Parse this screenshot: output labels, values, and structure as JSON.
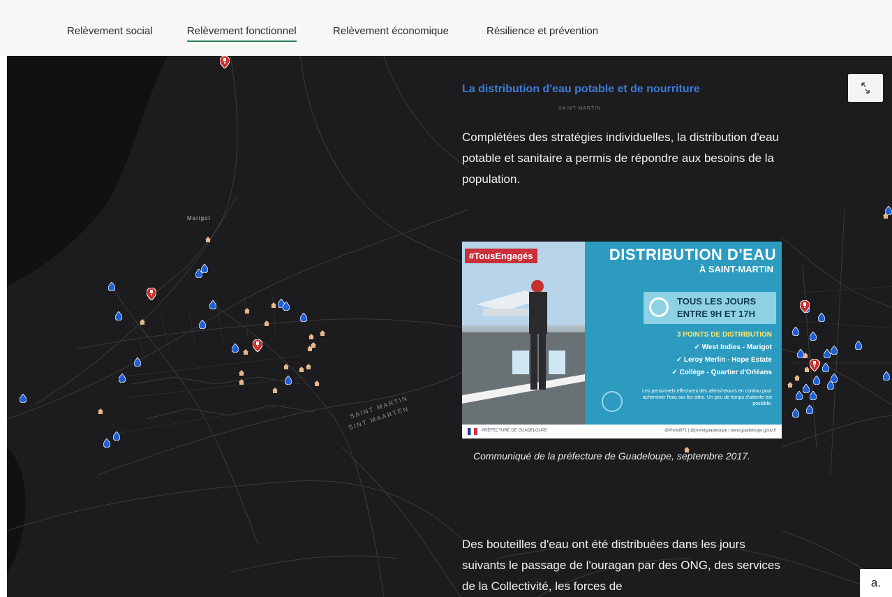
{
  "nav": {
    "tabs": [
      {
        "label": "Relèvement social",
        "active": false
      },
      {
        "label": "Relèvement fonctionnel",
        "active": true
      },
      {
        "label": "Relèvement économique",
        "active": false
      },
      {
        "label": "Résilience et prévention",
        "active": false
      }
    ]
  },
  "map": {
    "town_label": "Marigot",
    "border_labels": [
      "SAINT MARTIN",
      "SINT MAARTEN"
    ],
    "expand_icon": "expand-icon",
    "colors": {
      "background": "#1c1c1e",
      "water_pin": "#1f5fd6",
      "food_pin": "#e8b88a",
      "red_pin": "#c9302c"
    }
  },
  "panel": {
    "title": "La distribution d'eau potable et de nourriture",
    "subtitle": "SAINT MARTIN",
    "paragraph1": "Complétées des stratégies individuelles, la distribution d'eau potable et sanitaire a permis de répondre aux besoins de la population.",
    "caption": "Communiqué de la préfecture de Guadeloupe, septembre 2017.",
    "paragraph2": "Des bouteilles d'eau ont été distribuées dans les jours suivants le passage de l'ouragan par des ONG, des services de la Collectivité, les forces de"
  },
  "poster": {
    "hashtag": "#TousEngagés",
    "title": "DISTRIBUTION D'EAU",
    "subtitle": "À SAINT-MARTIN",
    "hours_line1": "TOUS LES JOURS",
    "hours_line2": "ENTRE 9H ET 17H",
    "points_title": "3 POINTS DE DISTRIBUTION",
    "points": [
      "✓ West Indies - Marigot",
      "✓ Leroy Merlin - Hope Estate",
      "✓ Collège - Quartier d'Orléans"
    ],
    "note": "Les personnels effectuent des allers/retours en continu pour acheminer l'eau sur les sites. Un peu de temps d'attente est possible.",
    "footer_pref": "PRÉFECTURE DE GUADELOUPE",
    "footer_social": "@Prefet971 | @prefetguadeloupe | www.guadeloupe.gouv.fr"
  },
  "corner_label": "a."
}
